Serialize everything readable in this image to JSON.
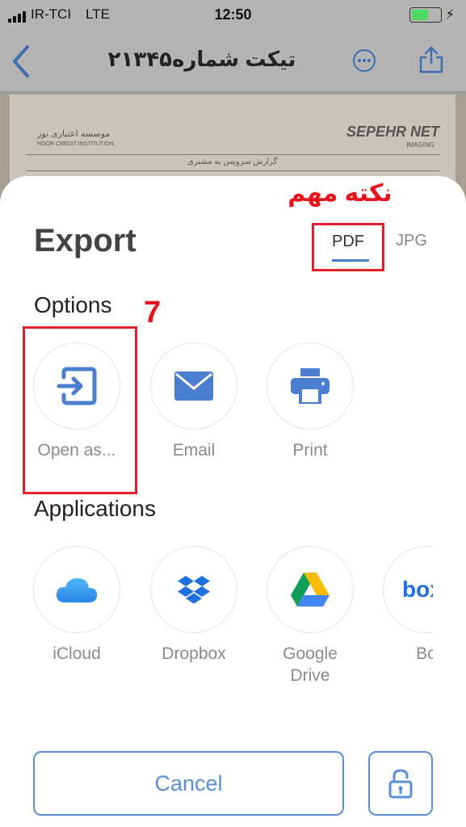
{
  "status_bar": {
    "carrier": "IR-TCI",
    "network": "LTE",
    "time": "12:50"
  },
  "nav": {
    "title": "تیکت شماره۲۱۳۴۵"
  },
  "document_preview": {
    "brand_left": "SEPEHR NET",
    "brand_left_sub": "IMAGING",
    "brand_right": "موسسه اعتباری نور",
    "brand_right_sub": "NOOR CREDIT INSTITUTION",
    "header_text": "گزارش سرویس به مشتری"
  },
  "annotation": {
    "note": "نکته مهم",
    "step": "7"
  },
  "sheet": {
    "title": "Export",
    "tabs": [
      {
        "label": "PDF",
        "selected": true
      },
      {
        "label": "JPG",
        "selected": false
      }
    ],
    "options_label": "Options",
    "options": [
      {
        "label": "Open as...",
        "icon": "open-as-icon"
      },
      {
        "label": "Email",
        "icon": "envelope-icon"
      },
      {
        "label": "Print",
        "icon": "printer-icon"
      }
    ],
    "applications_label": "Applications",
    "applications": [
      {
        "label": "iCloud",
        "icon": "icloud-icon"
      },
      {
        "label": "Dropbox",
        "icon": "dropbox-icon"
      },
      {
        "label": "Google Drive",
        "icon": "google-drive-icon"
      },
      {
        "label": "Bo",
        "icon": "box-icon"
      }
    ],
    "cancel_label": "Cancel"
  },
  "colors": {
    "accent": "#4a7fd0",
    "annotation_red": "#e0202a",
    "battery_green": "#4cd964"
  }
}
